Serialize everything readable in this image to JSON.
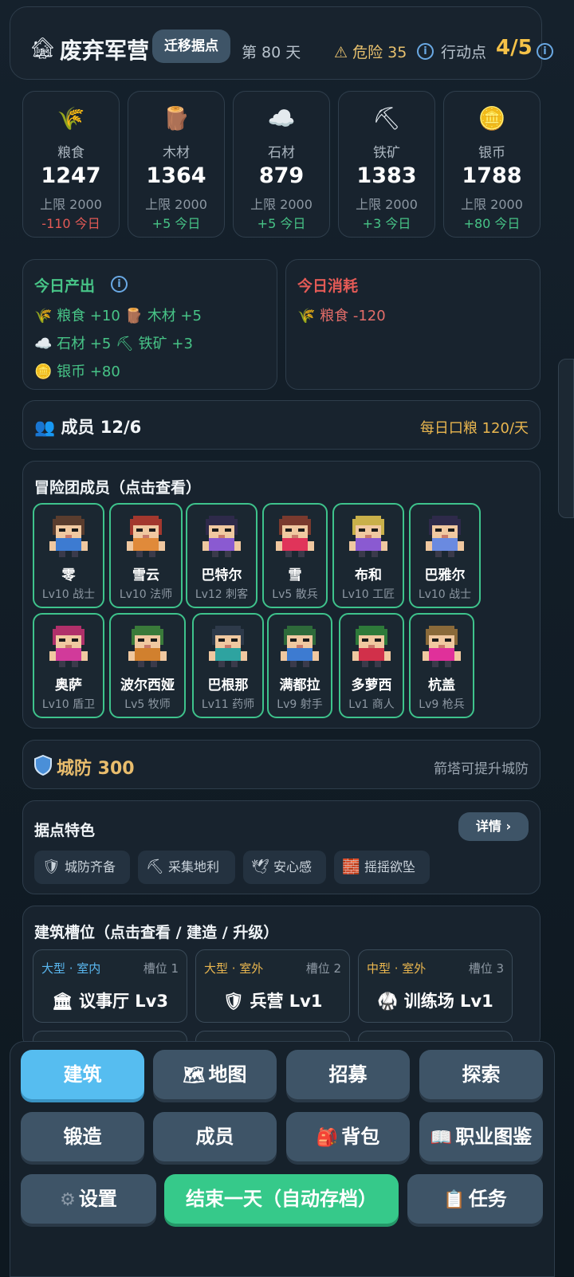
{
  "header": {
    "camp_icon": "🏚",
    "title": "废弃军营",
    "migrate_label": "迁移据点",
    "day_label": "第 80 天",
    "danger_label": "⚠ 危险 35",
    "ap_label": "行动点",
    "ap_value": "4/5",
    "info_glyph": "i"
  },
  "resources": [
    {
      "icon": "🌾",
      "name": "粮食",
      "amount": "1247",
      "cap": "上限 2000",
      "delta": "-110 今日",
      "delta_sign": "neg"
    },
    {
      "icon": "🪵",
      "name": "木材",
      "amount": "1364",
      "cap": "上限 2000",
      "delta": "+5 今日",
      "delta_sign": "pos"
    },
    {
      "icon": "☁️",
      "name": "石材",
      "amount": "879",
      "cap": "上限 2000",
      "delta": "+5 今日",
      "delta_sign": "pos"
    },
    {
      "icon": "⛏",
      "name": "铁矿",
      "amount": "1383",
      "cap": "上限 2000",
      "delta": "+3 今日",
      "delta_sign": "pos"
    },
    {
      "icon": "🪙",
      "name": "银币",
      "amount": "1788",
      "cap": "上限 2000",
      "delta": "+80 今日",
      "delta_sign": "pos"
    }
  ],
  "production": {
    "title": "今日产出",
    "lines": [
      "🌾 粮食 +10 🪵 木材 +5",
      "☁️ 石材 +5 ⛏ 铁矿 +3",
      "🪙 银币 +80"
    ]
  },
  "consumption": {
    "title": "今日消耗",
    "lines": [
      "🌾 粮食 -120"
    ]
  },
  "members_bar": {
    "title": "👥 成员 12/6",
    "ration": "每日口粮 120/天"
  },
  "team": {
    "title": "冒险团成员（点击查看）",
    "members": [
      {
        "name": "零",
        "level": "Lv10 战士",
        "hair": "#5a3d2e",
        "shirt": "#3d7bd1"
      },
      {
        "name": "雪云",
        "level": "Lv10 法师",
        "hair": "#a3382e",
        "shirt": "#e08a3a"
      },
      {
        "name": "巴特尔",
        "level": "Lv12 刺客",
        "hair": "#2e2a4a",
        "shirt": "#8a5ad1"
      },
      {
        "name": "雪",
        "level": "Lv5 散兵",
        "hair": "#7a3a2e",
        "shirt": "#e0345a"
      },
      {
        "name": "布和",
        "level": "Lv10 工匠",
        "hair": "#c9b04a",
        "shirt": "#8a5ad1"
      },
      {
        "name": "巴雅尔",
        "level": "Lv10 战士",
        "hair": "#2e2a4a",
        "shirt": "#6a8ae0"
      },
      {
        "name": "奥萨",
        "level": "Lv10 盾卫",
        "hair": "#b0306a",
        "shirt": "#d13a9a"
      },
      {
        "name": "波尔西娅",
        "level": "Lv5 牧师",
        "hair": "#3a7a3a",
        "shirt": "#d1802e"
      },
      {
        "name": "巴根那",
        "level": "Lv11 药师",
        "hair": "#2e3a4a",
        "shirt": "#2ea3a0"
      },
      {
        "name": "满都拉",
        "level": "Lv9 射手",
        "hair": "#2e6a3a",
        "shirt": "#3d7bd1"
      },
      {
        "name": "多萝西",
        "level": "Lv1 商人",
        "hair": "#2e7a3a",
        "shirt": "#d1304a"
      },
      {
        "name": "杭盖",
        "level": "Lv9 枪兵",
        "hair": "#8a6a3a",
        "shirt": "#e0309a"
      }
    ]
  },
  "defense": {
    "title": "城防 300",
    "note": "箭塔可提升城防"
  },
  "features": {
    "title": "据点特色",
    "detail_label": "详情 ›",
    "chips": [
      {
        "icon": "🛡",
        "label": "城防齐备"
      },
      {
        "icon": "⛏",
        "label": "采集地利"
      },
      {
        "icon": "🕊",
        "label": "安心感"
      },
      {
        "icon": "🧱",
        "label": "摇摇欲坠"
      }
    ]
  },
  "slots": {
    "title": "建筑槽位（点击查看 / 建造 / 升级）",
    "items": [
      {
        "type": "大型 · 室内",
        "type_color": "#5ab8f0",
        "index": "槽位 1",
        "icon": "🏛",
        "name": "议事厅 Lv3"
      },
      {
        "type": "大型 · 室外",
        "type_color": "#e9b64f",
        "index": "槽位 2",
        "icon": "🛡",
        "name": "兵营 Lv1"
      },
      {
        "type": "中型 · 室外",
        "type_color": "#e9b64f",
        "index": "槽位 3",
        "icon": "🥋",
        "name": "训练场 Lv1"
      }
    ]
  },
  "nav": {
    "build": "建筑",
    "map": "地图",
    "map_icon": "🗺",
    "recruit": "招募",
    "explore": "探索",
    "forge": "锻造",
    "members": "成员",
    "bag": "背包",
    "bag_icon": "🎒",
    "codex": "职业图鉴",
    "codex_icon": "📖",
    "settings": "设置",
    "settings_icon": "⚙",
    "end_day": "结束一天（自动存档）",
    "tasks": "任务",
    "tasks_icon": "📋"
  }
}
